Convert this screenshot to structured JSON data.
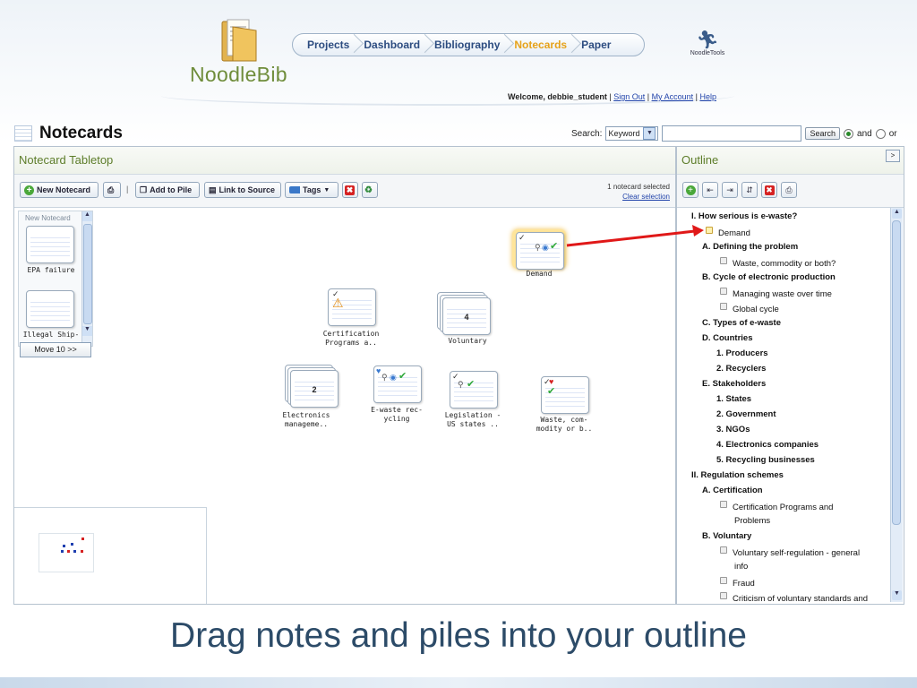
{
  "app": {
    "logo_text": "NoodleBib",
    "nav": [
      "Projects",
      "Dashboard",
      "Bibliography",
      "Notecards",
      "Paper"
    ],
    "nav_active": "Notecards",
    "partner_logo": "NoodleTools",
    "welcome_prefix": "Welcome, debbie_student",
    "links": [
      "Sign Out",
      "My Account",
      "Help"
    ]
  },
  "page": {
    "title": "Notecards",
    "search_label": "Search:",
    "search_mode": "Keyword",
    "search_button": "Search",
    "radio_and": "and",
    "radio_or": "or",
    "radio_selected": "and"
  },
  "tabletop": {
    "title": "Notecard Tabletop",
    "toolbar": {
      "new_notecard": "New Notecard",
      "add_to_pile": "Add to Pile",
      "link_to_source": "Link to Source",
      "tags": "Tags",
      "separator": "|"
    },
    "selection": {
      "count_text": "1 notecard selected",
      "clear": "Clear selection"
    },
    "new_stack": {
      "label": "New Notecard",
      "cards": [
        "EPA failure",
        "Illegal Ship-"
      ],
      "move_button": "Move 10 >>"
    },
    "cards": [
      {
        "label": "Demand",
        "selected": true
      },
      {
        "label": "Certification Programs a..",
        "icon": "warning"
      },
      {
        "label": "Voluntary",
        "pile_count": "4"
      },
      {
        "label": "Electronics manageme..",
        "pile_count": "2"
      },
      {
        "label": "E-waste rec-ycling"
      },
      {
        "label": "Legislation - US states .."
      },
      {
        "label": "Waste, com-modity or b.."
      }
    ]
  },
  "outline": {
    "title": "Outline",
    "items": [
      {
        "text": "I.  How serious is e-waste?",
        "bold": true
      },
      {
        "text": "Demand",
        "note": true,
        "highlight": true
      },
      {
        "text": "A.  Defining the problem",
        "bold": true
      },
      {
        "text": "Waste, commodity or both?",
        "note": true
      },
      {
        "text": "B.  Cycle of electronic production",
        "bold": true
      },
      {
        "text": "Managing waste over time",
        "note": true
      },
      {
        "text": "Global cycle",
        "note": true
      },
      {
        "text": "C.  Types of e-waste",
        "bold": true
      },
      {
        "text": "D.  Countries",
        "bold": true
      },
      {
        "text": "1.  Producers",
        "bold": true
      },
      {
        "text": "2.  Recyclers",
        "bold": true
      },
      {
        "text": "E.  Stakeholders",
        "bold": true
      },
      {
        "text": "1.  States",
        "bold": true
      },
      {
        "text": "2.  Government",
        "bold": true
      },
      {
        "text": "3.  NGOs",
        "bold": true
      },
      {
        "text": "4.  Electronics companies",
        "bold": true
      },
      {
        "text": "5.  Recycling businesses",
        "bold": true
      },
      {
        "text": "II.  Regulation schemes",
        "bold": true
      },
      {
        "text": "A.  Certification",
        "bold": true
      },
      {
        "text": "Certification Programs and",
        "note": true
      },
      {
        "text": "Problems",
        "note": true,
        "continuation": true
      },
      {
        "text": "B.  Voluntary",
        "bold": true
      },
      {
        "text": "Voluntary self-regulation - general",
        "note": true
      },
      {
        "text": "info",
        "note": true,
        "continuation": true
      },
      {
        "text": "Fraud",
        "note": true
      },
      {
        "text": "Criticism of voluntary standards and",
        "note": true
      }
    ]
  },
  "caption": "Drag notes and piles into your outline",
  "colors": {
    "brand_green": "#6f8d3b",
    "nav_text": "#2c4c80",
    "nav_active": "#e6a21a",
    "arrow": "#e01818",
    "caption": "#2c4b68"
  }
}
